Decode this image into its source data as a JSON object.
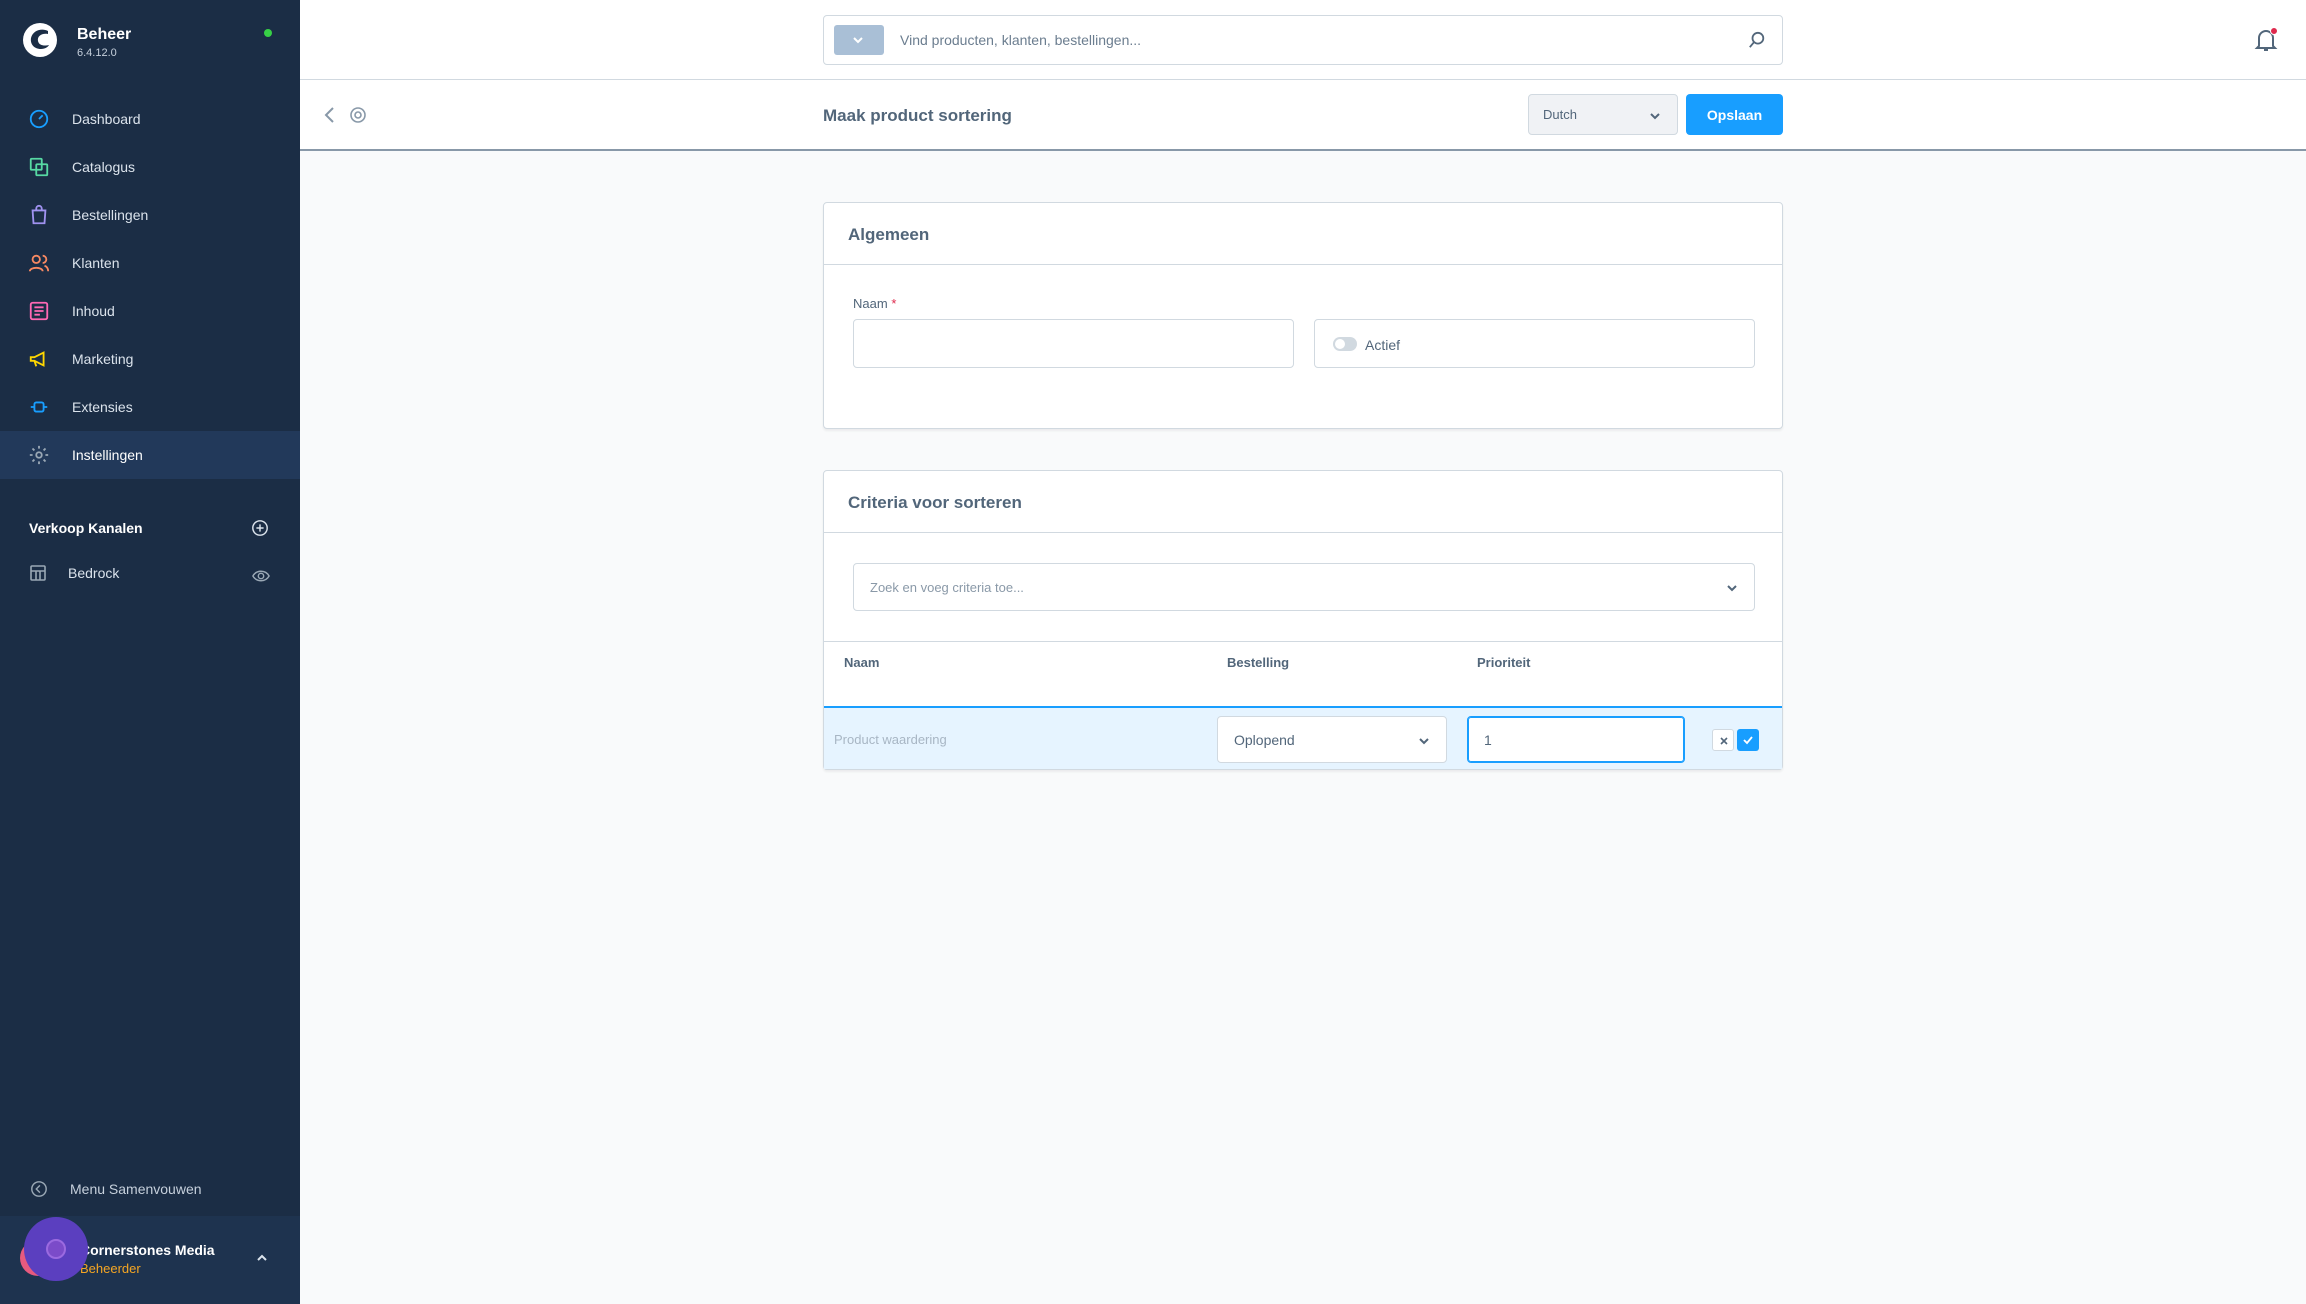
{
  "sidebar": {
    "brand_title": "Beheer",
    "version": "6.4.12.0",
    "nav": [
      {
        "label": "Dashboard",
        "icon": "dashboard-icon",
        "color": "#189eff"
      },
      {
        "label": "Catalogus",
        "icon": "catalog-icon",
        "color": "#57d9a3"
      },
      {
        "label": "Bestellingen",
        "icon": "shopping-bag-icon",
        "color": "#a092f0"
      },
      {
        "label": "Klanten",
        "icon": "customers-icon",
        "color": "#f88962"
      },
      {
        "label": "Inhoud",
        "icon": "content-icon",
        "color": "#ff68b4"
      },
      {
        "label": "Marketing",
        "icon": "megaphone-icon",
        "color": "#ffd700"
      },
      {
        "label": "Extensies",
        "icon": "plug-icon",
        "color": "#189eff"
      },
      {
        "label": "Instellingen",
        "icon": "gear-icon",
        "color": "#9aa8b5"
      }
    ],
    "sales_channels_heading": "Verkoop Kanalen",
    "sales_channel_item": "Bedrock",
    "collapse_label": "Menu Samenvouwen",
    "user": {
      "name": "Cornerstones Media",
      "role": "Beheerder"
    }
  },
  "topbar": {
    "search_placeholder": "Vind producten, klanten, bestellingen..."
  },
  "smartbar": {
    "title": "Maak product sortering",
    "language": "Dutch",
    "save_label": "Opslaan"
  },
  "general_card": {
    "title": "Algemeen",
    "name_label": "Naam",
    "required_mark": "*",
    "name_value": "",
    "active_label": "Actief",
    "active_on": false
  },
  "criteria_card": {
    "title": "Criteria voor sorteren",
    "search_placeholder": "Zoek en voeg criteria toe...",
    "columns": [
      "Naam",
      "Bestelling",
      "Prioriteit"
    ],
    "rows": [
      {
        "name": "Product waardering",
        "order": "Oplopend",
        "priority": "1"
      }
    ]
  },
  "colors": {
    "sidebar_bg": "#1b2d45",
    "accent": "#189eff",
    "status_online": "#37d046"
  }
}
